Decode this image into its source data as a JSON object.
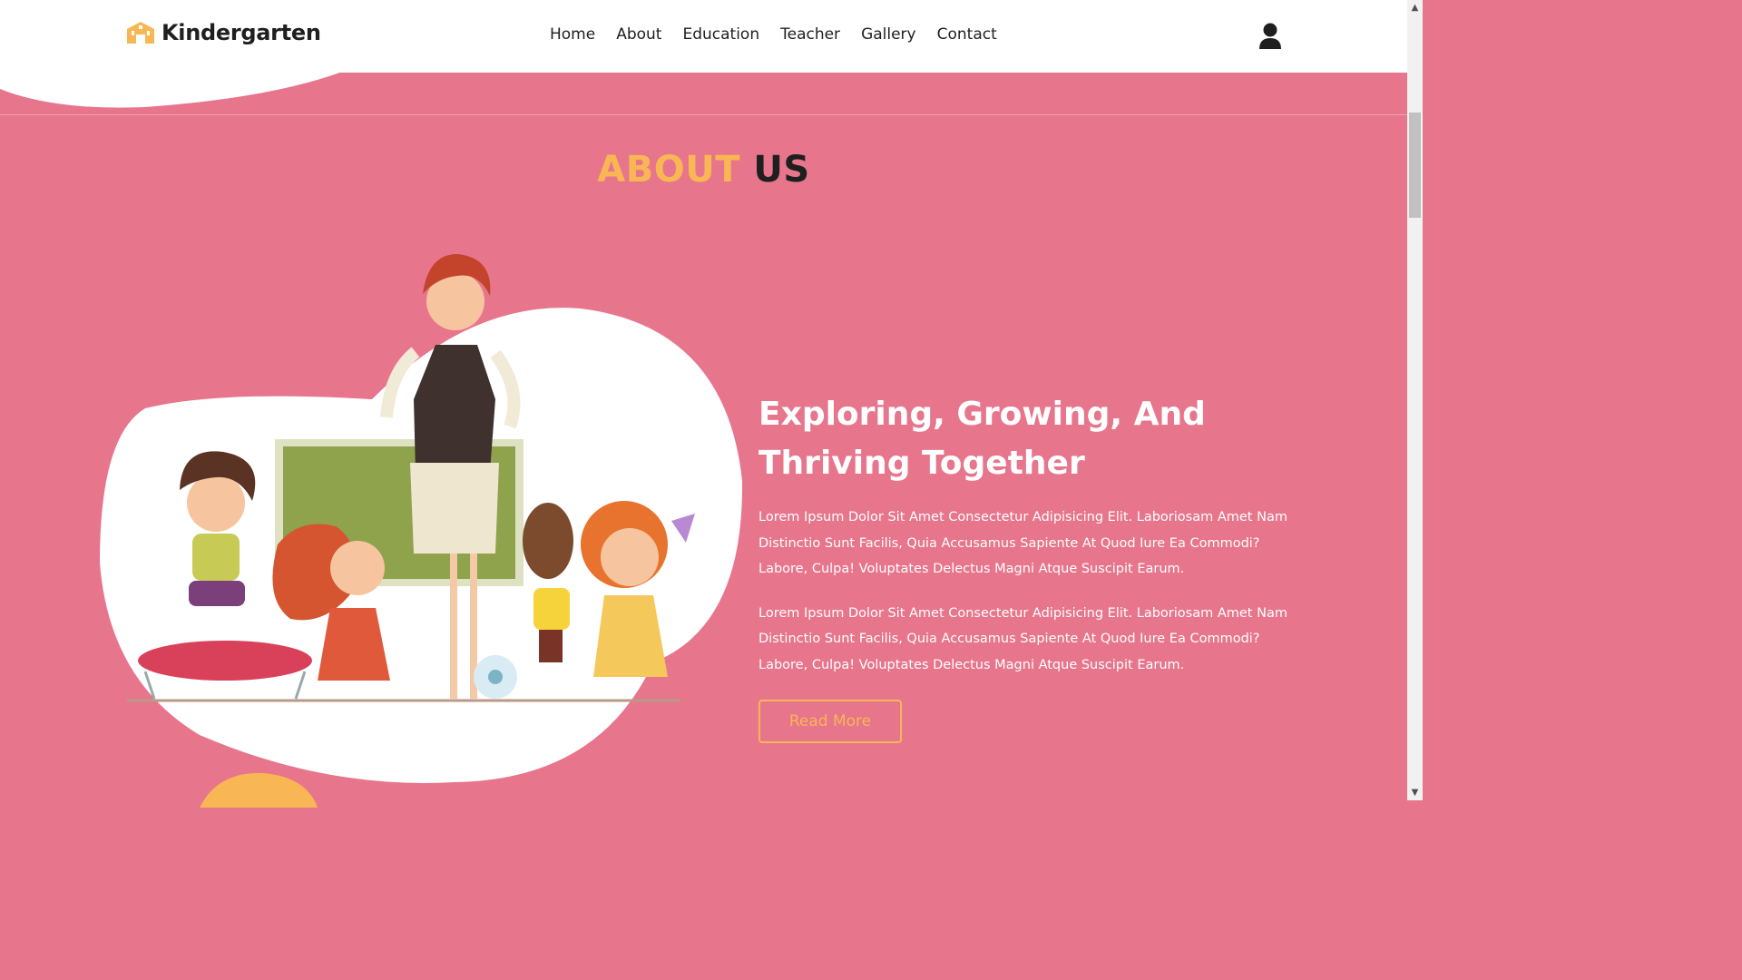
{
  "header": {
    "logo_text": "Kindergarten",
    "nav": [
      "Home",
      "About",
      "Education",
      "Teacher",
      "Gallery",
      "Contact"
    ],
    "user_icon": "user-icon"
  },
  "about": {
    "title_highlight": "ABOUT",
    "title_rest": "US",
    "heading": "Exploring, Growing, And Thriving Together",
    "paragraphs": [
      "Lorem Ipsum Dolor Sit Amet Consectetur Adipisicing Elit. Laboriosam Amet Nam Distinctio Sunt Facilis, Quia Accusamus Sapiente At Quod Iure Ea Commodi? Labore, Culpa! Voluptates Delectus Magni Atque Suscipit Earum.",
      "Lorem Ipsum Dolor Sit Amet Consectetur Adipisicing Elit. Laboriosam Amet Nam Distinctio Sunt Facilis, Quia Accusamus Sapiente At Quod Iure Ea Commodi? Labore, Culpa! Voluptates Delectus Magni Atque Suscipit Earum."
    ],
    "button": "Read More"
  },
  "colors": {
    "background": "#e7758c",
    "accent": "#f9b654",
    "dark": "#1f1f1f",
    "white": "#ffffff"
  },
  "icons": [
    "school-logo-icon",
    "user-icon",
    "scroll-up-icon",
    "scroll-down-icon"
  ]
}
